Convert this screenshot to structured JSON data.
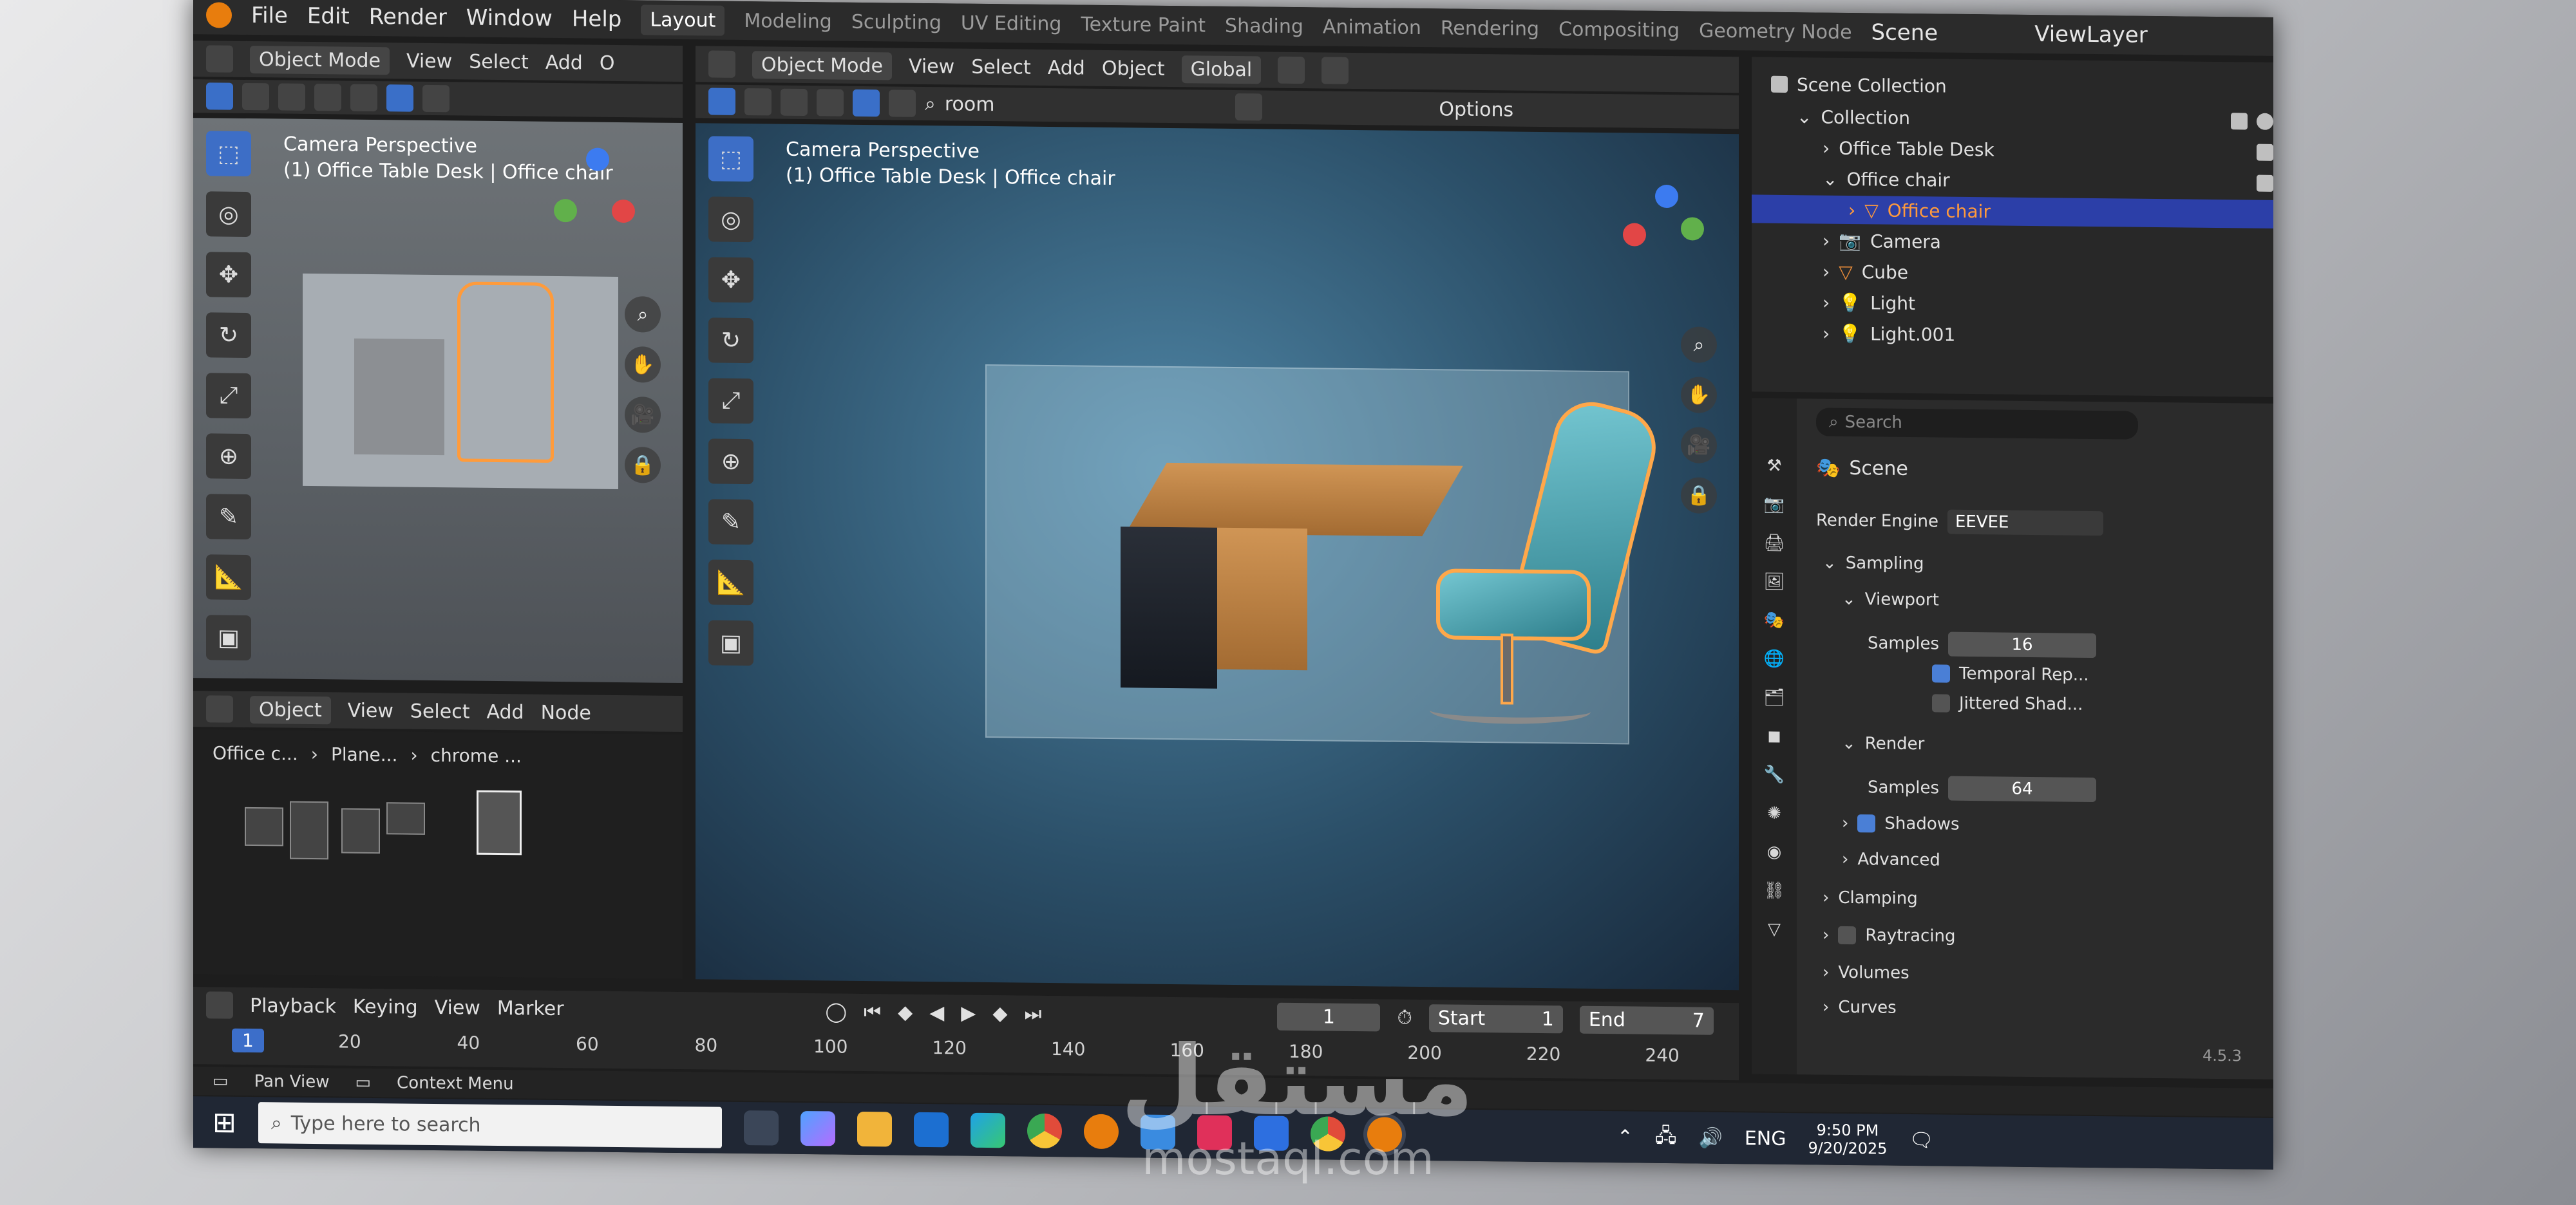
{
  "menu": {
    "items": [
      "File",
      "Edit",
      "Render",
      "Window",
      "Help"
    ],
    "workspaces": [
      "Layout",
      "Modeling",
      "Sculpting",
      "UV Editing",
      "Texture Paint",
      "Shading",
      "Animation",
      "Rendering",
      "Compositing",
      "Geometry Node"
    ],
    "active_workspace": "Layout",
    "scene_label": "Scene",
    "view_layer_label": "ViewLayer"
  },
  "left_viewport": {
    "mode": "Object Mode",
    "menus": [
      "View",
      "Select",
      "Add",
      "O"
    ],
    "title": "Camera Perspective",
    "subtitle": "(1) Office Table Desk | Office chair"
  },
  "main_viewport": {
    "mode": "Object Mode",
    "menus": [
      "View",
      "Select",
      "Add",
      "Object"
    ],
    "transform": "Global",
    "search_text": "room",
    "options_label": "Options",
    "title": "Camera Perspective",
    "subtitle": "(1) Office Table Desk | Office chair"
  },
  "node_editor": {
    "mode": "Object",
    "menus": [
      "View",
      "Select",
      "Add",
      "Node"
    ],
    "breadcrumb": [
      "Office c...",
      "Plane...",
      "chrome ..."
    ]
  },
  "outliner": {
    "root": "Scene Collection",
    "rows": [
      {
        "label": "Collection",
        "indent": 1
      },
      {
        "label": "Office Table Desk",
        "indent": 2
      },
      {
        "label": "Office chair",
        "indent": 2
      },
      {
        "label": "Office chair",
        "indent": 3,
        "selected": true
      },
      {
        "label": "Camera",
        "indent": 2
      },
      {
        "label": "Cube",
        "indent": 2
      },
      {
        "label": "Light",
        "indent": 2
      },
      {
        "label": "Light.001",
        "indent": 2
      }
    ]
  },
  "properties": {
    "search_placeholder": "Search",
    "context": "Scene",
    "render_engine_label": "Render Engine",
    "render_engine": "EEVEE",
    "sampling_label": "Sampling",
    "viewport_label": "Viewport",
    "viewport_samples_label": "Samples",
    "viewport_samples": "16",
    "temporal_label": "Temporal Rep...",
    "jittered_label": "Jittered Shad...",
    "render_label": "Render",
    "render_samples_label": "Samples",
    "render_samples": "64",
    "shadows_label": "Shadows",
    "advanced_label": "Advanced",
    "clamping_label": "Clamping",
    "raytracing_label": "Raytracing",
    "volumes_label": "Volumes",
    "curves_label": "Curves",
    "version": "4.5.3"
  },
  "timeline": {
    "menus": [
      "Playback",
      "Keying",
      "View",
      "Marker"
    ],
    "current_frame": "1",
    "start_label": "Start",
    "start": "1",
    "end_label": "End",
    "end": "7",
    "frame_marks": [
      "1",
      "20",
      "40",
      "60",
      "80",
      "100",
      "120",
      "140",
      "160",
      "180",
      "200",
      "220",
      "240"
    ]
  },
  "statusbar": {
    "pan_view": "Pan View",
    "context_menu": "Context Menu"
  },
  "taskbar": {
    "search_placeholder": "Type here to search",
    "language": "ENG",
    "time": "9:50 PM",
    "date": "9/20/2025"
  },
  "watermark": {
    "arabic": "مستقل",
    "latin": "mostaql.com"
  }
}
